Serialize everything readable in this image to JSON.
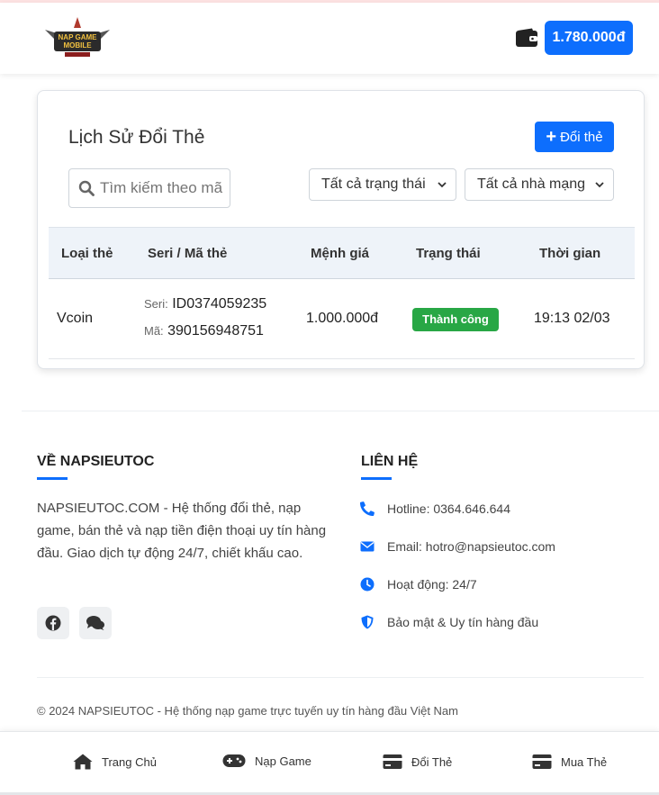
{
  "header": {
    "logo_text": "NAP GAME MOBILE",
    "balance": "1.780.000đ"
  },
  "history": {
    "title": "Lịch Sử Đổi Thẻ",
    "exchange_button": "Đổi thẻ",
    "search_placeholder": "Tìm kiếm theo mã",
    "status_filter": "Tất cả trạng thái",
    "network_filter": "Tất cả nhà mạng",
    "columns": [
      "Loại thẻ",
      "Seri / Mã thẻ",
      "Mệnh giá",
      "Trạng thái",
      "Thời gian"
    ],
    "rows": [
      {
        "card_type": "Vcoin",
        "serial_label": "Seri:",
        "serial": "ID0374059235",
        "code_label": "Mã:",
        "code": "390156948751",
        "value": "1.000.000đ",
        "status": "Thành công",
        "time": "19:13 02/03"
      }
    ]
  },
  "footer": {
    "about_title": "VỀ NAPSIEUTOC",
    "about_text": "NAPSIEUTOC.COM - Hệ thống đổi thẻ, nạp game, bán thẻ và nạp tiền điện thoại uy tín hàng đầu. Giao dịch tự động 24/7, chiết khấu cao.",
    "contact_title": "LIÊN HỆ",
    "contacts": {
      "hotline": "Hotline: 0364.646.644",
      "email": "Email: hotro@napsieutoc.com",
      "hours": "Hoạt động: 24/7",
      "security": "Bảo mật & Uy tín hàng đầu"
    },
    "copyright": "© 2024 NAPSIEUTOC - Hệ thống nạp game trực tuyến uy tín hàng đầu Việt Nam"
  },
  "bottom_nav": {
    "home": "Trang Chủ",
    "game": "Nạp Game",
    "exchange": "Đổi Thẻ",
    "buy": "Mua Thẻ"
  },
  "colors": {
    "primary": "#0d6efd",
    "success": "#28a745",
    "table_header_bg": "#eef3f9"
  }
}
